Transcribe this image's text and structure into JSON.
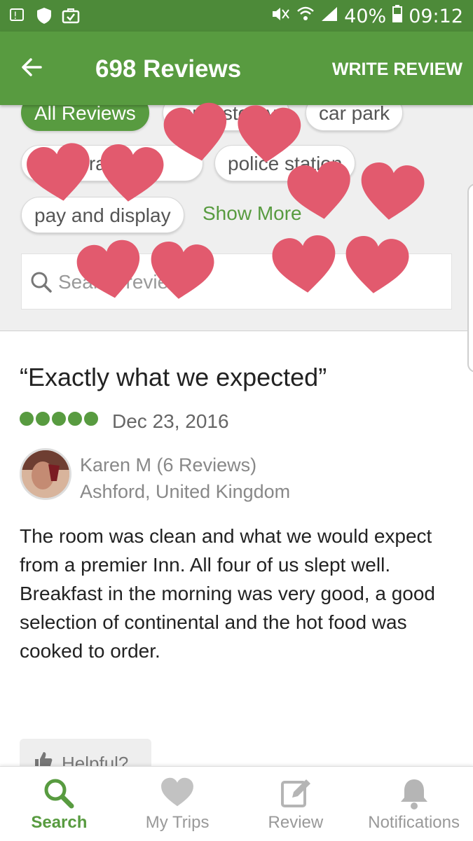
{
  "status_bar": {
    "battery": "40%",
    "time": "09:12"
  },
  "app_bar": {
    "title": "698 Reviews",
    "write_review_label": "WRITE REVIEW"
  },
  "filters": {
    "chips": [
      "All Reviews",
      "multi storey",
      "car park",
      "restaurant",
      "police station",
      "pay and display"
    ],
    "show_more": "Show More"
  },
  "search": {
    "placeholder": "Search reviews"
  },
  "review": {
    "title": "“Exactly what we expected”",
    "rating": 5,
    "date": "Dec 23, 2016",
    "author": "Karen M (6 Reviews)",
    "location": "Ashford, United Kingdom",
    "text": "The room was clean and what we would expect from a premier Inn.  All four of us slept well. Breakfast in the morning was very good, a good selection of continental and the hot food was cooked to order.",
    "helpful_label": "Helpful?"
  },
  "bottom_nav": [
    {
      "label": "Search",
      "icon": "search-icon"
    },
    {
      "label": "My Trips",
      "icon": "heart-icon"
    },
    {
      "label": "Review",
      "icon": "edit-icon"
    },
    {
      "label": "Notifications",
      "icon": "bell-icon"
    }
  ],
  "colors": {
    "brand": "#589b40",
    "status_bar": "#4d8a39",
    "heart": "#e25a6e"
  }
}
